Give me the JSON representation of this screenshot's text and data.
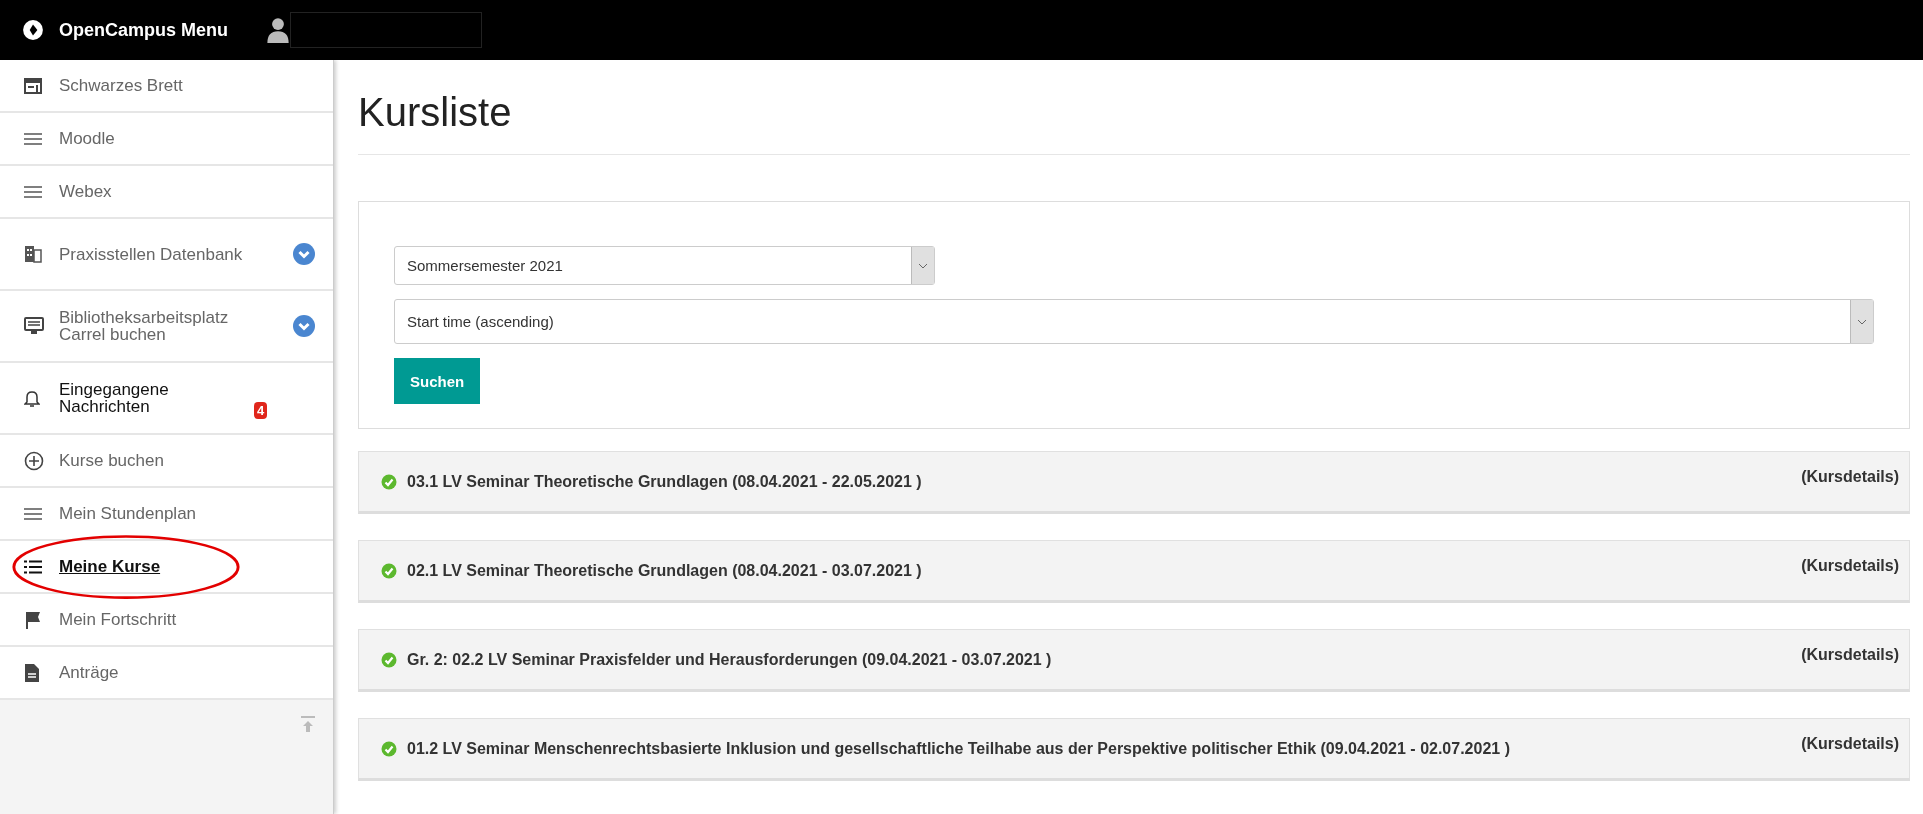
{
  "topbar": {
    "title": "OpenCampus Menu"
  },
  "sidebar": {
    "items": [
      {
        "label": "Schwarzes Brett",
        "kind": "board",
        "selected": false,
        "has_submenu": false,
        "circled": false
      },
      {
        "label": "Moodle",
        "kind": "lines",
        "selected": false,
        "has_submenu": false,
        "circled": false
      },
      {
        "label": "Webex",
        "kind": "lines",
        "selected": false,
        "has_submenu": false,
        "circled": false
      },
      {
        "label": "Praxisstellen Datenbank",
        "kind": "building",
        "selected": false,
        "has_submenu": true,
        "circled": false
      },
      {
        "label": "Bibliotheksarbeitsplatz Carrel buchen",
        "kind": "monitor",
        "selected": false,
        "has_submenu": true,
        "circled": false
      },
      {
        "label": "Eingegangene Nachrichten",
        "kind": "bell",
        "selected": false,
        "has_submenu": false,
        "circled": false,
        "badge": "4"
      },
      {
        "label": "Kurse buchen",
        "kind": "plus",
        "selected": false,
        "has_submenu": false,
        "circled": false
      },
      {
        "label": "Mein Stundenplan",
        "kind": "lines",
        "selected": false,
        "has_submenu": false,
        "circled": false
      },
      {
        "label": "Meine Kurse",
        "kind": "list",
        "selected": true,
        "has_submenu": false,
        "circled": true
      },
      {
        "label": "Mein Fortschritt",
        "kind": "flag",
        "selected": false,
        "has_submenu": false,
        "circled": false
      },
      {
        "label": "Anträge",
        "kind": "document",
        "selected": false,
        "has_submenu": false,
        "circled": false
      }
    ]
  },
  "page": {
    "title": "Kursliste",
    "filters": {
      "semester": "Sommersemester 2021",
      "sort": "Start time (ascending)",
      "button": "Suchen"
    },
    "courses": [
      {
        "title": "03.1 LV Seminar Theoretische Grundlagen (08.04.2021 - 22.05.2021 )",
        "link": "(Kursdetails)"
      },
      {
        "title": "02.1 LV Seminar Theoretische Grundlagen (08.04.2021 - 03.07.2021 )",
        "link": "(Kursdetails)"
      },
      {
        "title": "Gr. 2: 02.2 LV Seminar Praxisfelder und Herausforderungen (09.04.2021 - 03.07.2021 )",
        "link": "(Kursdetails)"
      },
      {
        "title": "01.2 LV Seminar Menschenrechtsbasierte Inklusion und gesellschaftliche Teilhabe aus der Perspektive politischer Ethik (09.04.2021 - 02.07.2021 )",
        "link": "(Kursdetails)"
      }
    ]
  }
}
